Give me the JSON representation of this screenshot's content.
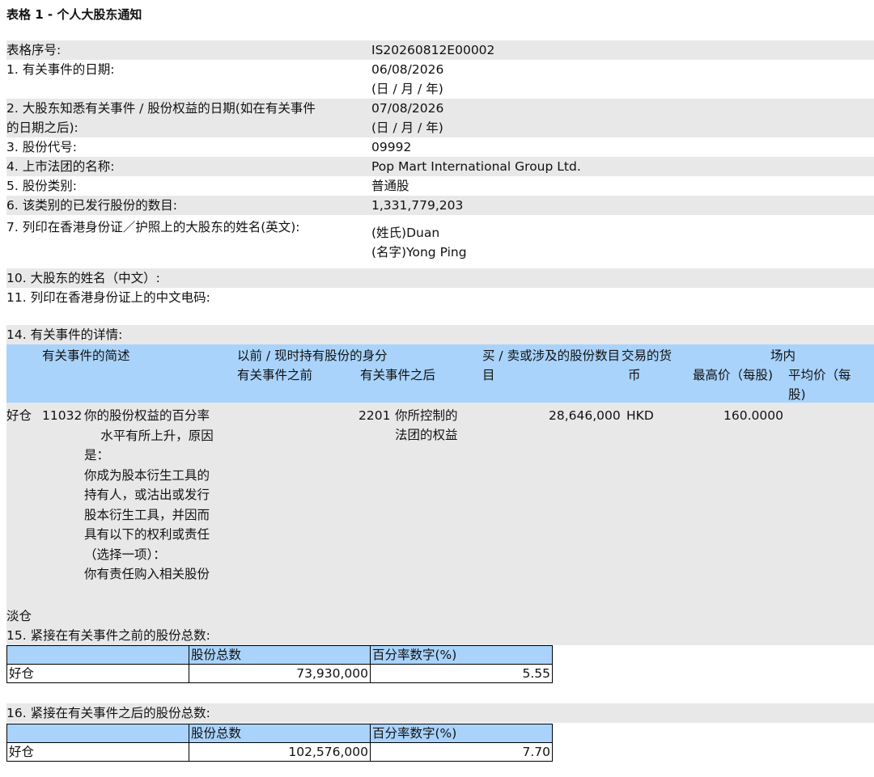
{
  "title": "表格 1 - 个人大股东通知",
  "rows": {
    "serial": {
      "label": "表格序号:",
      "value": "IS20260812E00002"
    },
    "event_date": {
      "label": "1. 有关事件的日期:",
      "value": "06/08/2026",
      "hint": "(日 / 月 / 年)"
    },
    "aware_date": {
      "label_line1": "2. 大股东知悉有关事件 / 股份权益的日期(如在有关事件",
      "label_line2": "的日期之后):",
      "value": "07/08/2026",
      "hint": "(日 / 月 / 年)"
    },
    "stock_code": {
      "label": "3. 股份代号:",
      "value": "09992"
    },
    "company": {
      "label": "4. 上市法团的名称:",
      "value": "Pop Mart International Group Ltd."
    },
    "share_class": {
      "label": "5. 股份类别:",
      "value": "普通股"
    },
    "issued": {
      "label": "6. 该类别的已发行股份的数目:",
      "value": "1,331,779,203"
    },
    "name_en": {
      "label": "7. 列印在香港身份证／护照上的大股东的姓名(英文):",
      "surname": "(姓氏)Duan",
      "given": "(名字)Yong Ping"
    },
    "name_cn": {
      "label": "10. 大股东的姓名（中文）:"
    },
    "ccc": {
      "label": "11. 列印在香港身份证上的中文电码:"
    }
  },
  "details": {
    "label": "14. 有关事件的详情:",
    "headers": {
      "desc": "有关事件的简述",
      "capacity": "以前 / 现时持有股份的身分",
      "before": "有关事件之前",
      "after": "有关事件之后",
      "shares": "买 / 卖或涉及的股份数目",
      "currency_line1": "交易的货",
      "currency_line2": "币",
      "onex": "场内",
      "highest": "最高价（每股)",
      "average_line1": "平均价（每",
      "average_line2": "股)"
    },
    "row": {
      "position": "好仓",
      "code": "11032",
      "description": [
        "你的股份权益的百分率",
        "水平有所上升，原因",
        "是：",
        "你成为股本衍生工具的",
        "持有人，或沽出或发行",
        "股本衍生工具，并因而",
        "具有以下的权利或责任",
        "（选择一项）：",
        "你有责任购入相关股份"
      ],
      "capacity_code": "2201",
      "capacity_text_line1": "你所控制的",
      "capacity_text_line2": "法团的权益",
      "shares": "28,646,000",
      "currency": "HKD",
      "highest": "160.0000"
    },
    "short_label": "淡仓"
  },
  "before_total": {
    "label": "15. 紧接在有关事件之前的股份总数:",
    "col_shares": "股份总数",
    "col_pct": "百分率数字(%)",
    "position": "好仓",
    "shares": "73,930,000",
    "pct": "5.55"
  },
  "after_total": {
    "label": "16. 紧接在有关事件之后的股份总数:",
    "col_shares": "股份总数",
    "col_pct": "百分率数字(%)",
    "position": "好仓",
    "shares": "102,576,000",
    "pct": "7.70"
  }
}
